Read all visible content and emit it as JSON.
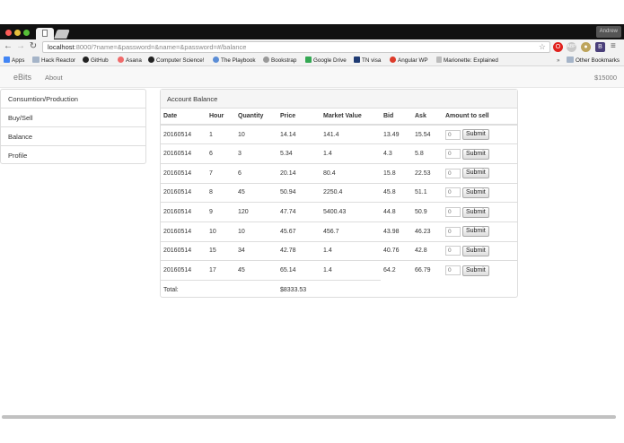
{
  "browser": {
    "profile_label": "Andrew",
    "url_host": "localhost",
    "url_rest": ":8000/?name=&password=&name=&password=#/balance",
    "bookmarks": [
      {
        "label": "Apps",
        "icon": "apps-grid-icon",
        "color": "#4285f4"
      },
      {
        "label": "Hack Reactor",
        "icon": "folder-icon",
        "color": "#a5b4c8"
      },
      {
        "label": "GitHub",
        "icon": "github-icon",
        "color": "#222222"
      },
      {
        "label": "Asana",
        "icon": "asana-icon",
        "color": "#f06a6a"
      },
      {
        "label": "Computer Science!",
        "icon": "github-icon",
        "color": "#222222"
      },
      {
        "label": "The Playbook",
        "icon": "globe-icon",
        "color": "#5b8dd6"
      },
      {
        "label": "Bookstrap",
        "icon": "globe-icon",
        "color": "#999999"
      },
      {
        "label": "Google Drive",
        "icon": "drive-icon",
        "color": "#34a853"
      },
      {
        "label": "TN visa",
        "icon": "tn-icon",
        "color": "#1f3b73"
      },
      {
        "label": "Angular WP",
        "icon": "angular-icon",
        "color": "#dd3b2a"
      },
      {
        "label": "Marionette: Explained",
        "icon": "page-icon",
        "color": "#bbbbbb"
      }
    ],
    "other_bookmarks": "Other Bookmarks"
  },
  "app": {
    "brand": "eBits",
    "nav_about": "About",
    "balance": "$15000"
  },
  "sidebar": {
    "items": [
      {
        "label": "Consumtion/Production"
      },
      {
        "label": "Buy/Sell"
      },
      {
        "label": "Balance"
      },
      {
        "label": "Profile"
      }
    ]
  },
  "panel": {
    "heading": "Account Balance",
    "columns": [
      "Date",
      "Hour",
      "Quantity",
      "Price",
      "Market Value",
      "Bid",
      "Ask",
      "Amount to sell"
    ],
    "input_placeholder": "0",
    "submit_label": "Submit",
    "rows": [
      {
        "date": "20160514",
        "hour": "1",
        "quantity": "10",
        "price": "14.14",
        "market_value": "141.4",
        "bid": "13.49",
        "ask": "15.54"
      },
      {
        "date": "20160514",
        "hour": "6",
        "quantity": "3",
        "price": "5.34",
        "market_value": "1.4",
        "bid": "4.3",
        "ask": "5.8"
      },
      {
        "date": "20160514",
        "hour": "7",
        "quantity": "6",
        "price": "20.14",
        "market_value": "80.4",
        "bid": "15.8",
        "ask": "22.53"
      },
      {
        "date": "20160514",
        "hour": "8",
        "quantity": "45",
        "price": "50.94",
        "market_value": "2250.4",
        "bid": "45.8",
        "ask": "51.1"
      },
      {
        "date": "20160514",
        "hour": "9",
        "quantity": "120",
        "price": "47.74",
        "market_value": "5400.43",
        "bid": "44.8",
        "ask": "50.9"
      },
      {
        "date": "20160514",
        "hour": "10",
        "quantity": "10",
        "price": "45.67",
        "market_value": "456.7",
        "bid": "43.98",
        "ask": "46.23"
      },
      {
        "date": "20160514",
        "hour": "15",
        "quantity": "34",
        "price": "42.78",
        "market_value": "1.4",
        "bid": "40.76",
        "ask": "42.8"
      },
      {
        "date": "20160514",
        "hour": "17",
        "quantity": "45",
        "price": "65.14",
        "market_value": "1.4",
        "bid": "64.2",
        "ask": "66.79"
      }
    ],
    "total_label": "Total:",
    "total_value": "$8333.53"
  }
}
